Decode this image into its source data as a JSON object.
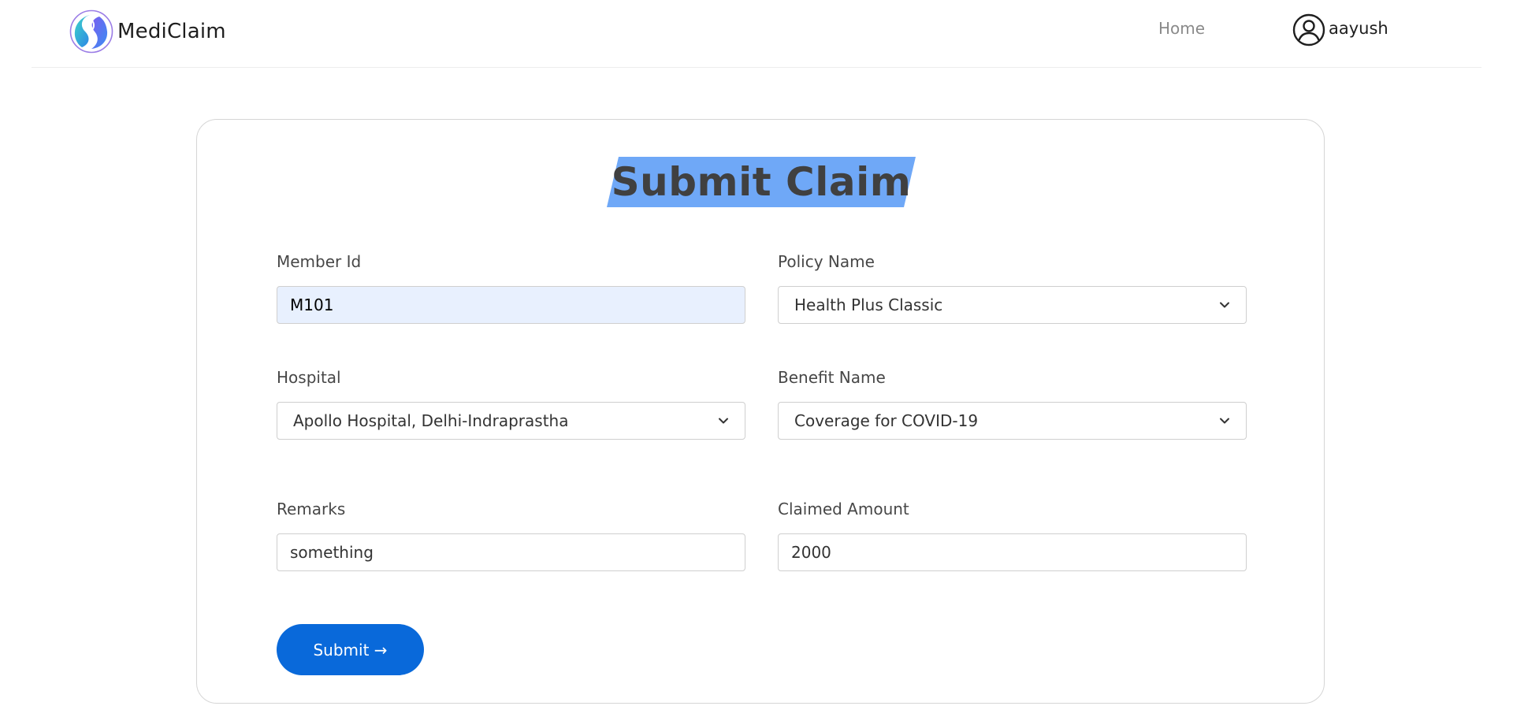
{
  "navbar": {
    "brand_name": "MediClaim",
    "home_label": "Home",
    "username": "aayush"
  },
  "form": {
    "title": "Submit Claim",
    "member_id": {
      "label": "Member Id",
      "value": "M101"
    },
    "policy_name": {
      "label": "Policy Name",
      "selected": "Health Plus Classic"
    },
    "hospital": {
      "label": "Hospital",
      "selected": "Apollo Hospital, Delhi-Indraprastha"
    },
    "benefit_name": {
      "label": "Benefit Name",
      "selected": "Coverage for COVID-19"
    },
    "remarks": {
      "label": "Remarks",
      "value": "something"
    },
    "claimed_amount": {
      "label": "Claimed Amount",
      "value": "2000"
    },
    "submit_label": "Submit →"
  },
  "colors": {
    "title_highlight": "#6fa8f7",
    "submit_button": "#0969da",
    "autofill_background": "#e8f0fe"
  },
  "icons": {
    "logo": "mediclaim-logo-icon",
    "user": "user-circle-icon",
    "select_arrow": "chevron-down-icon"
  }
}
